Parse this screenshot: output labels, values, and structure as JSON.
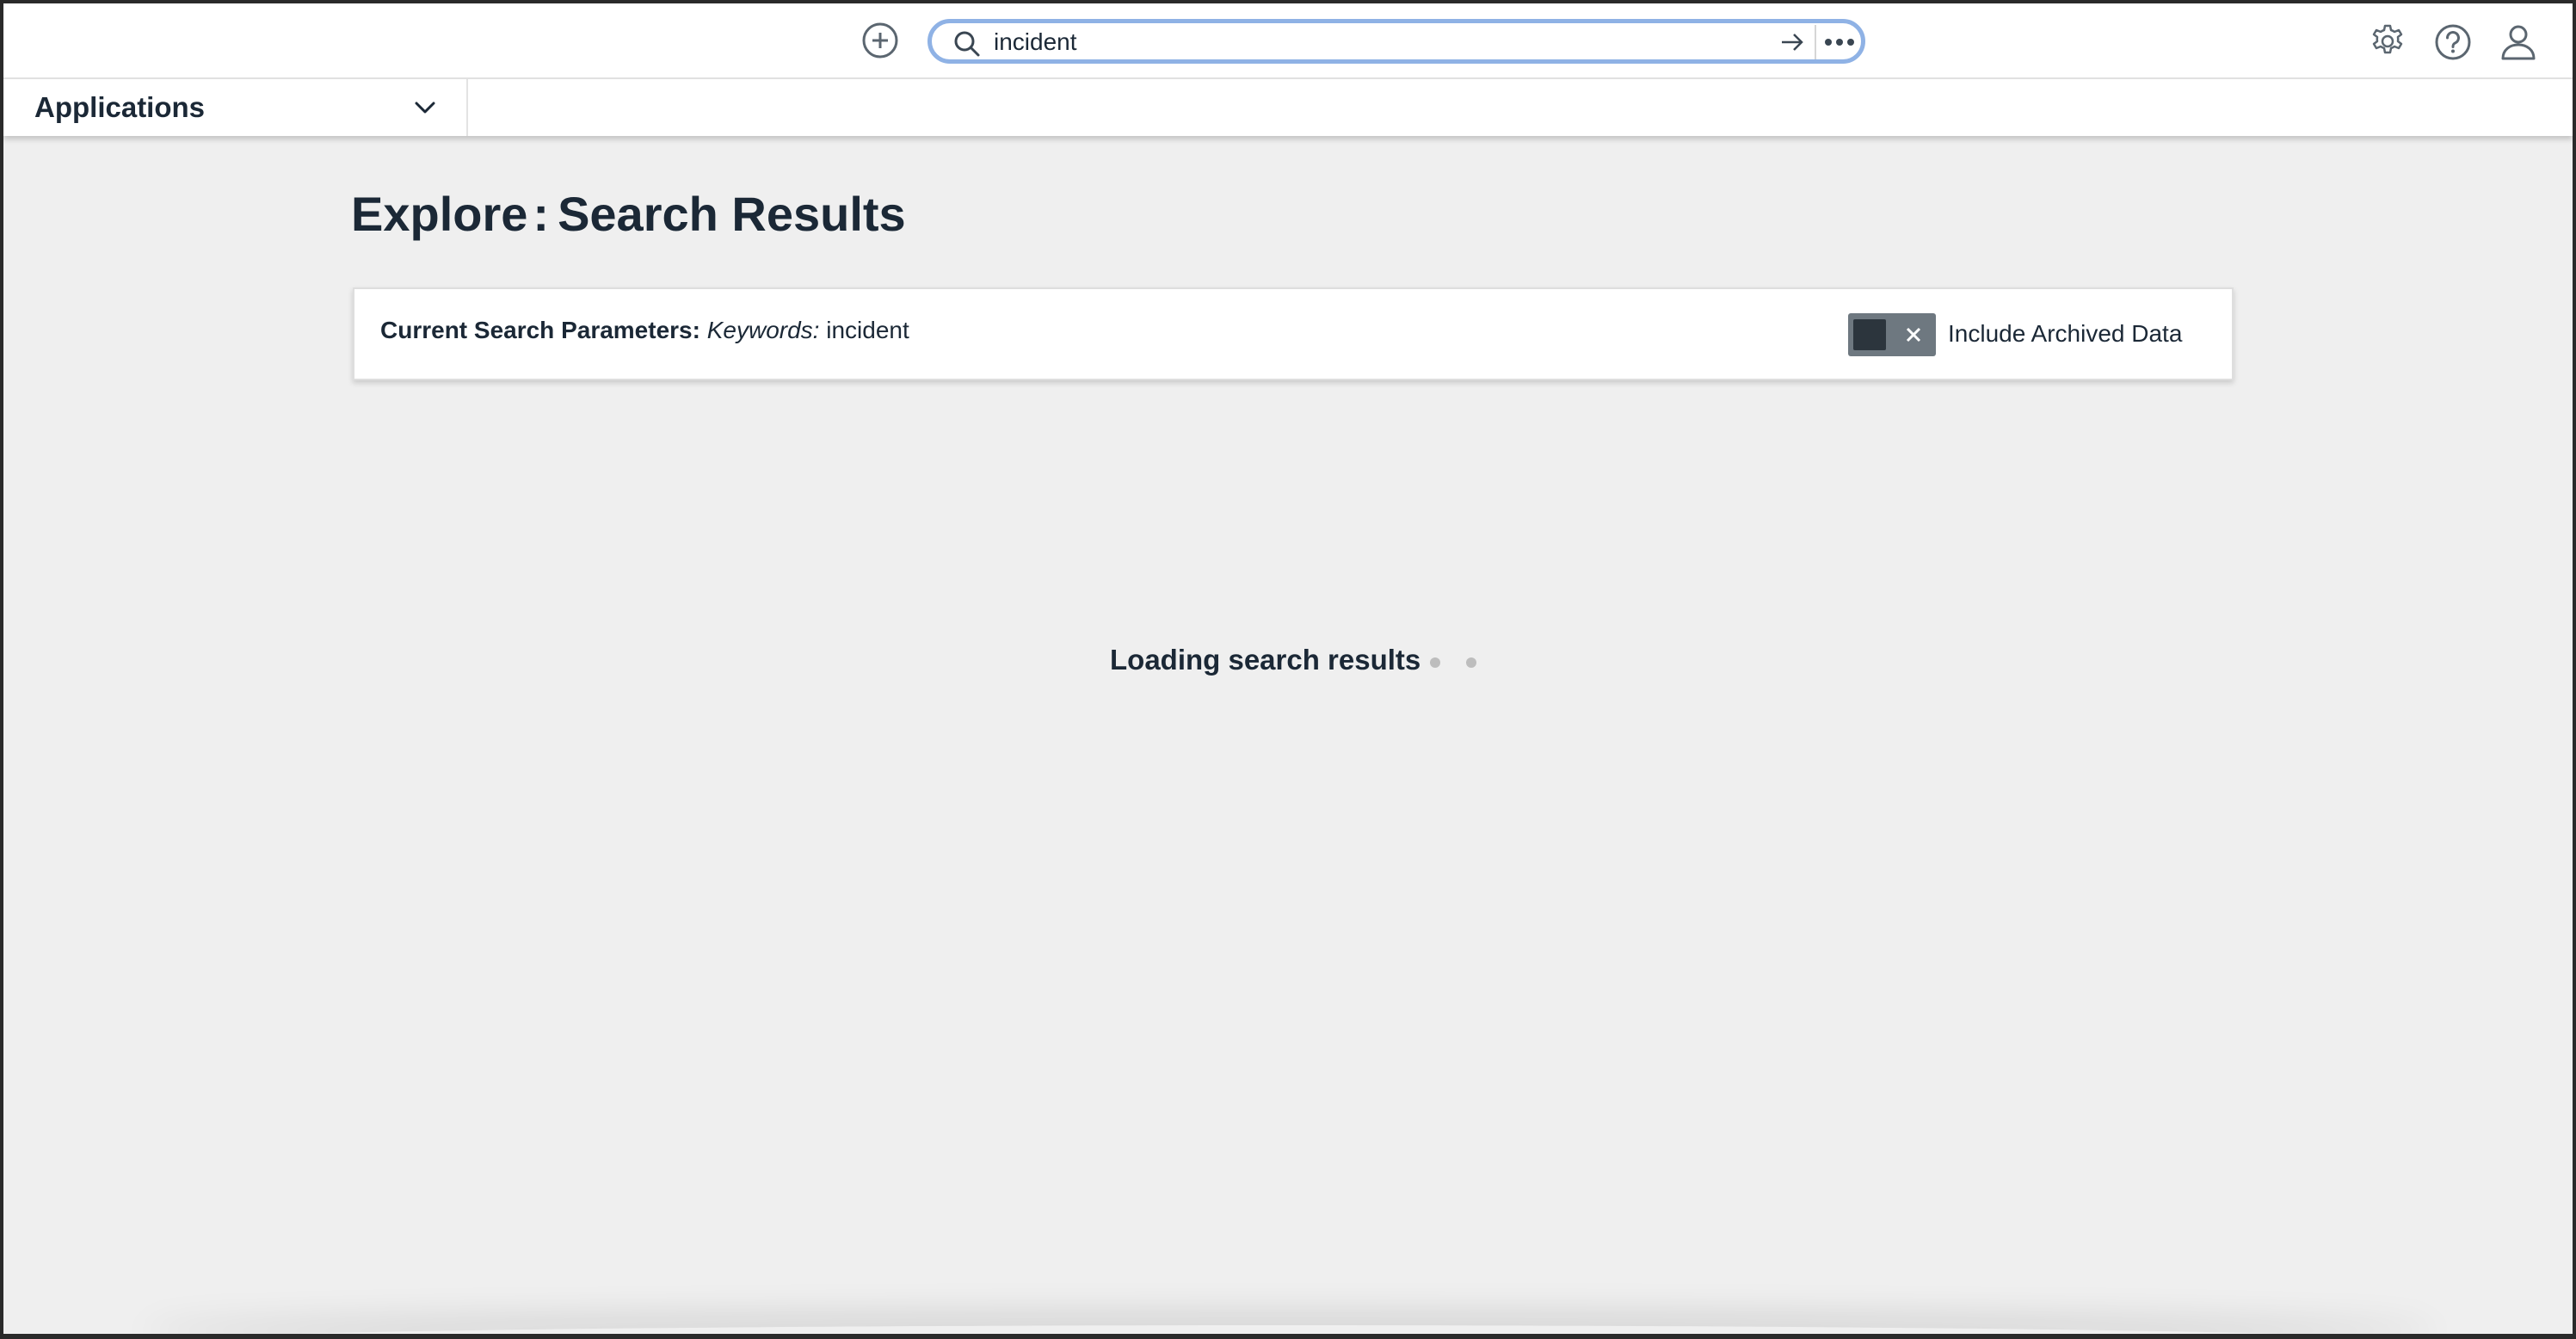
{
  "header": {
    "search": {
      "value": "incident",
      "placeholder": ""
    },
    "icons": {
      "add": "plus-circle-icon",
      "search": "search-icon",
      "submit": "arrow-right-icon",
      "more": "more-horizontal-icon",
      "settings": "gear-icon",
      "help": "help-circle-icon",
      "user": "user-icon"
    }
  },
  "apps": {
    "label": "Applications"
  },
  "page": {
    "title_prefix": "Explore",
    "title_separator": ":",
    "title_main": "Search Results"
  },
  "params": {
    "label": "Current Search Parameters:",
    "keywords_label": "Keywords:",
    "keywords_value": "incident",
    "archived_label": "Include Archived Data",
    "archived_enabled": false
  },
  "loading": {
    "text": "Loading search results"
  },
  "colors": {
    "focus_ring": "#8fb2e5",
    "text": "#1b2836",
    "page_bg": "#efefef",
    "toggle_bg": "#6e7880",
    "toggle_knob": "#2c353d"
  }
}
